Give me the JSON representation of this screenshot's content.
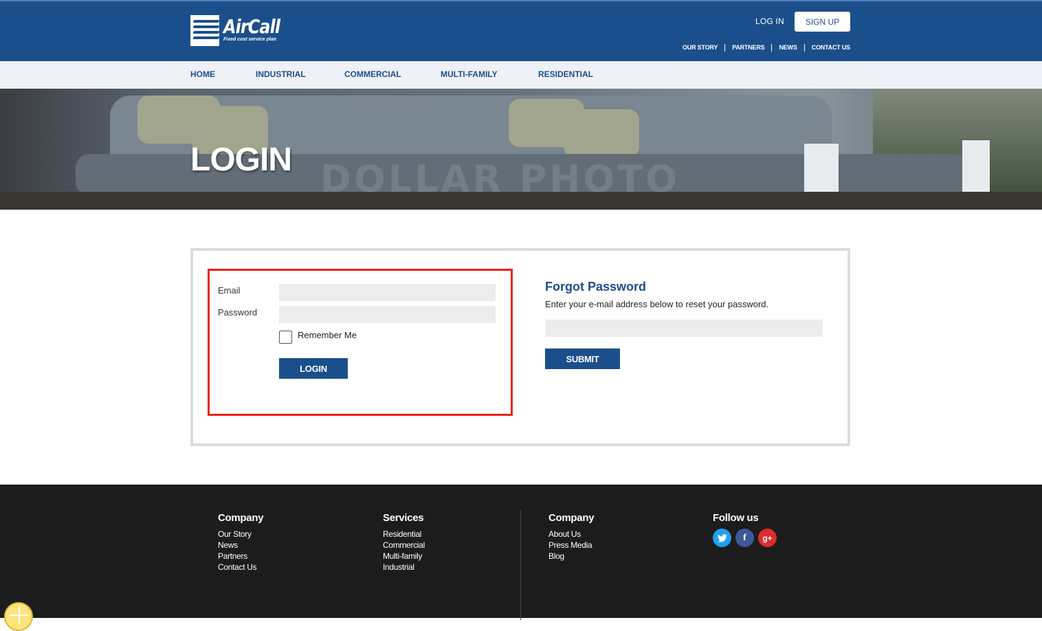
{
  "brand": {
    "name": "AirCall",
    "tagline": "Fixed cost service plan"
  },
  "header": {
    "login_label": "LOG IN",
    "signup_label": "SIGN UP",
    "links": [
      "OUR STORY",
      "PARTNERS",
      "NEWS",
      "CONTACT US"
    ]
  },
  "nav": {
    "items": [
      "HOME",
      "INDUSTRIAL",
      "COMMERCIAL",
      "MULTI-FAMILY",
      "RESIDENTIAL"
    ]
  },
  "hero": {
    "title": "LOGIN",
    "watermark": "DOLLAR PHOTO"
  },
  "login_form": {
    "email_label": "Email",
    "email_value": "",
    "password_label": "Password",
    "password_value": "",
    "remember_label": "Remember Me",
    "remember_checked": false,
    "submit_label": "LOGIN"
  },
  "forgot_password": {
    "title": "Forgot Password",
    "description": "Enter your e-mail address below to reset your password.",
    "email_value": "",
    "submit_label": "SUBMIT"
  },
  "footer": {
    "col1": {
      "title": "Company",
      "links": [
        "Our Story",
        "News",
        "Partners",
        "Contact Us"
      ]
    },
    "col2": {
      "title": "Services",
      "links": [
        "Residential",
        "Commercial",
        "Multi-family",
        "Industrial"
      ]
    },
    "col3": {
      "title": "Company",
      "links": [
        "About Us",
        "Press Media",
        "Blog"
      ]
    },
    "col4": {
      "title": "Follow us",
      "social": [
        "twitter-icon",
        "facebook-icon",
        "google-plus-icon"
      ]
    }
  },
  "colors": {
    "primary": "#1b4f8c",
    "highlight": "#ee2211",
    "footer_bg": "#1c1c1c"
  }
}
